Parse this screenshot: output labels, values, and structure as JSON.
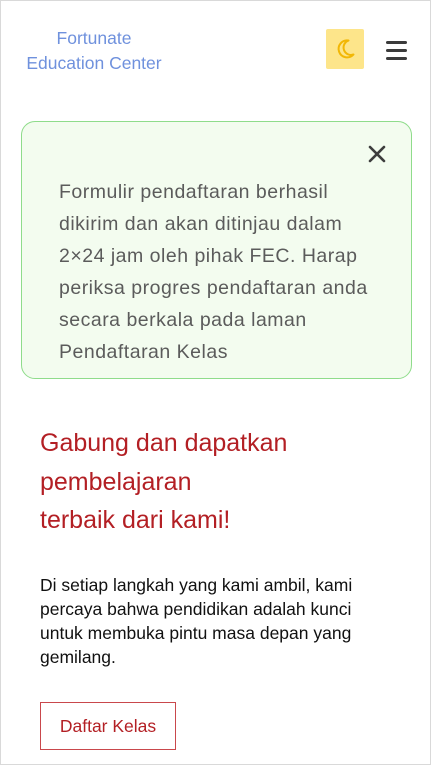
{
  "header": {
    "brand_line1": "Fortunate",
    "brand_line2": "Education Center",
    "theme_icon": "moon-icon",
    "menu_icon": "hamburger-menu-icon"
  },
  "alert": {
    "message": "Formulir pendaftaran berhasil dikirim dan akan ditinjau dalam 2×24 jam oleh pihak FEC. Harap periksa progres pendaftaran anda secara berkala pada laman Pendaftaran Kelas",
    "close_icon": "close-icon"
  },
  "hero": {
    "title_line1": "Gabung dan dapatkan",
    "title_line2": "pembelajaran",
    "title_line3": "terbaik dari kami!",
    "description": "Di setiap langkah yang kami ambil, kami percaya bahwa pendidikan adalah kunci untuk membuka pintu masa depan yang gemilang.",
    "cta_label": "Daftar Kelas"
  },
  "colors": {
    "brand": "#6f91dd",
    "accent": "#b31f24",
    "alert_border": "#8fdc8b",
    "alert_bg": "#f3fcef",
    "theme_toggle_bg": "#fde58a"
  }
}
